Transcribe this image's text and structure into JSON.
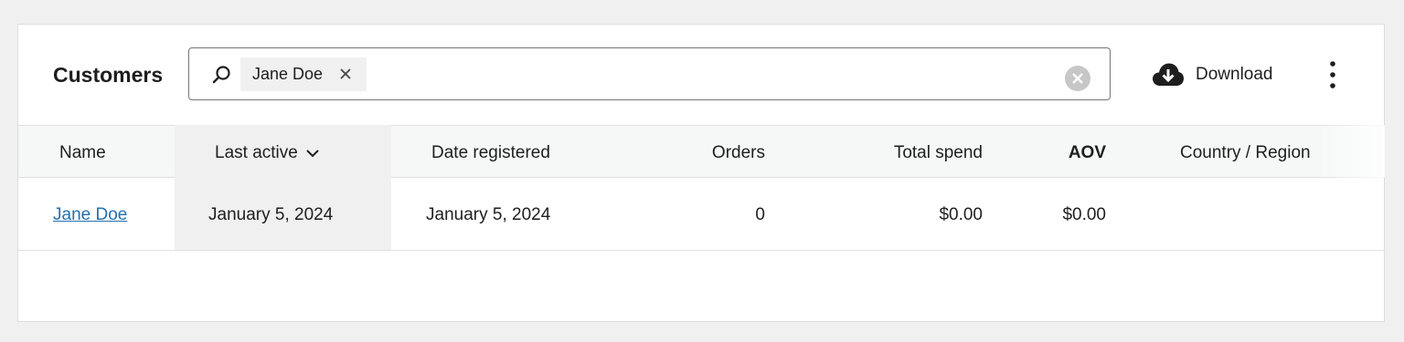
{
  "header": {
    "title": "Customers",
    "search": {
      "chip_label": "Jane Doe"
    },
    "download_label": "Download"
  },
  "table": {
    "columns": [
      "Name",
      "Last active",
      "Date registered",
      "Orders",
      "Total spend",
      "AOV",
      "Country / Region"
    ],
    "sorted_column": "Last active",
    "rows": [
      {
        "name": "Jane Doe",
        "last_active": "January 5, 2024",
        "date_registered": "January 5, 2024",
        "orders": "0",
        "total_spend": "$0.00",
        "aov": "$0.00",
        "country": ""
      }
    ]
  },
  "colors": {
    "link": "#2271b1",
    "header_bg": "#f6f7f7",
    "sorted_bg": "#f0f0f0",
    "page_bg": "#f0f0f0"
  },
  "icons": {
    "search": "search-icon",
    "chip_remove": "close-icon",
    "clear": "clear-circle-icon",
    "download": "cloud-download-icon",
    "more": "more-vertical-icon",
    "sort": "chevron-down-icon"
  }
}
